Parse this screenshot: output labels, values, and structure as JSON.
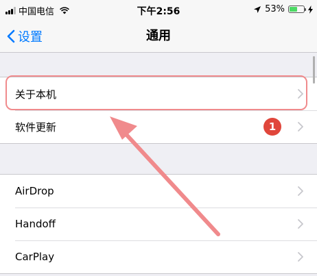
{
  "status_bar": {
    "carrier": "中国电信",
    "time": "下午2:56",
    "battery_percent_label": "53%",
    "battery_level": 0.53,
    "icons": [
      "signal-icon",
      "wifi-icon",
      "location-icon",
      "battery-icon",
      "charging-icon"
    ]
  },
  "nav": {
    "back_label": "设置",
    "title": "通用"
  },
  "group1": {
    "rows": [
      {
        "label": "关于本机"
      },
      {
        "label": "软件更新",
        "badge": "1"
      }
    ]
  },
  "group2": {
    "rows": [
      {
        "label": "AirDrop"
      },
      {
        "label": "Handoff"
      },
      {
        "label": "CarPlay"
      }
    ]
  },
  "colors": {
    "accent": "#007aff",
    "badge": "#e0463b",
    "highlight": "#f08a8c",
    "battery": "#4cd964"
  }
}
